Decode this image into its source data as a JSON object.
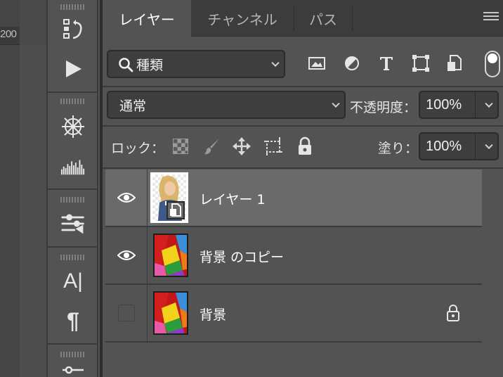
{
  "ruler": {
    "label": "200"
  },
  "tools": [
    {
      "name": "history-icon"
    },
    {
      "name": "play-icon"
    },
    {
      "name": "brush-settings-icon"
    },
    {
      "name": "histogram-icon"
    },
    {
      "name": "adjustments-icon"
    },
    {
      "name": "character-icon",
      "glyph": "A|"
    },
    {
      "name": "paragraph-icon",
      "glyph": "¶"
    },
    {
      "name": "properties-icon"
    }
  ],
  "tabs": [
    {
      "label": "レイヤー",
      "active": true
    },
    {
      "label": "チャンネル",
      "active": false
    },
    {
      "label": "パス",
      "active": false
    }
  ],
  "filter": {
    "kind_label": "種類",
    "icons": [
      "image-filter-icon",
      "adjustment-filter-icon",
      "type-filter-icon",
      "shape-filter-icon",
      "smart-object-filter-icon",
      "filter-toggle-icon"
    ]
  },
  "blend": {
    "mode": "通常",
    "opacity_label": "不透明度：",
    "opacity_value": "100%"
  },
  "lock": {
    "label": "ロック：",
    "icons": [
      "lock-transparency-icon",
      "lock-pixels-icon",
      "lock-position-icon",
      "lock-artboard-icon",
      "lock-all-icon"
    ],
    "fill_label": "塗り：",
    "fill_value": "100%"
  },
  "layers": [
    {
      "name": "レイヤー 1",
      "visible": true,
      "selected": true,
      "locked": false,
      "thumbnail": "smart-object-portrait"
    },
    {
      "name": "背景 のコピー",
      "visible": true,
      "selected": false,
      "locked": false,
      "thumbnail": "colorful-stripes"
    },
    {
      "name": "背景",
      "visible": false,
      "selected": false,
      "locked": true,
      "thumbnail": "colorful-stripes"
    }
  ],
  "colors": {
    "panel_bg": "#535353",
    "tab_bar_bg": "#3c3c3c",
    "field_bg": "#3e3e3e",
    "selected_row_bg": "#6a6a6a",
    "text": "#e6e6e6"
  }
}
